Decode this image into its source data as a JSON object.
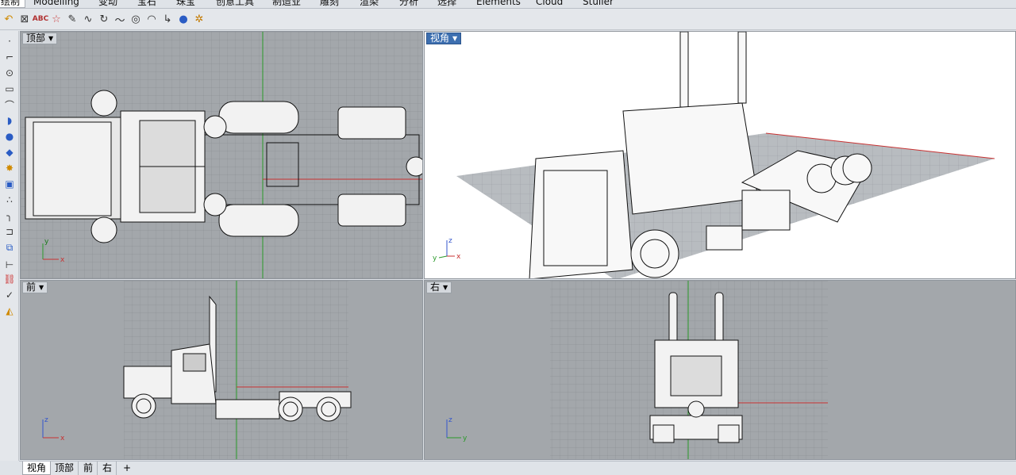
{
  "tabs": [
    {
      "label": "绘制",
      "active": true
    },
    {
      "label": "Modelling",
      "active": false
    },
    {
      "label": "变动",
      "active": false
    },
    {
      "label": "宝石",
      "active": false
    },
    {
      "label": "珠宝",
      "active": false
    },
    {
      "label": "创意工具",
      "active": false
    },
    {
      "label": "制造业",
      "active": false
    },
    {
      "label": "雕刻",
      "active": false
    },
    {
      "label": "渲染",
      "active": false
    },
    {
      "label": "分析",
      "active": false
    },
    {
      "label": "选择",
      "active": false
    },
    {
      "label": "Elements",
      "active": false
    },
    {
      "label": "Cloud",
      "active": false
    },
    {
      "label": "Stuller",
      "active": false
    }
  ],
  "toolbar_icons": [
    "undo-arrow-icon",
    "crossed-box-icon",
    "text-abc-icon",
    "star-icon",
    "pencil-icon",
    "curve-icon",
    "rotate-icon",
    "wave-icon",
    "circle-target-icon",
    "arc-icon",
    "corner-arrow-icon",
    "spheres-icon",
    "pointer-gear-icon"
  ],
  "sidebar_icons": [
    "point-icon",
    "polyline-icon",
    "circle-icon",
    "rectangle-icon",
    "curve-icon",
    "shell-icon",
    "sphere-icon",
    "plane-icon",
    "explode-icon",
    "box-icon",
    "points-icon",
    "fillet-icon",
    "offset-icon",
    "group-icon",
    "dimension-icon",
    "chain-icon",
    "check-icon",
    "paint-icon"
  ],
  "viewports": {
    "top": {
      "label": "顶部",
      "axis_x": "x",
      "axis_y": "y"
    },
    "perspective": {
      "label": "视角",
      "axis_x": "x",
      "axis_y": "y",
      "axis_z": "z"
    },
    "front": {
      "label": "前",
      "axis_x": "x",
      "axis_z": "z"
    },
    "right": {
      "label": "右",
      "axis_y": "y",
      "axis_z": "z"
    }
  },
  "bottom_tabs": [
    "视角",
    "顶部",
    "前",
    "右"
  ],
  "bottom_add": "+",
  "colors": {
    "grid_bg": "#a3a7ab",
    "grid_line": "#8e9296",
    "persp_bg": "#ffffff",
    "axis_red": "#c83232",
    "axis_green": "#2a9a2a",
    "active_label": "#3d6fb0"
  }
}
